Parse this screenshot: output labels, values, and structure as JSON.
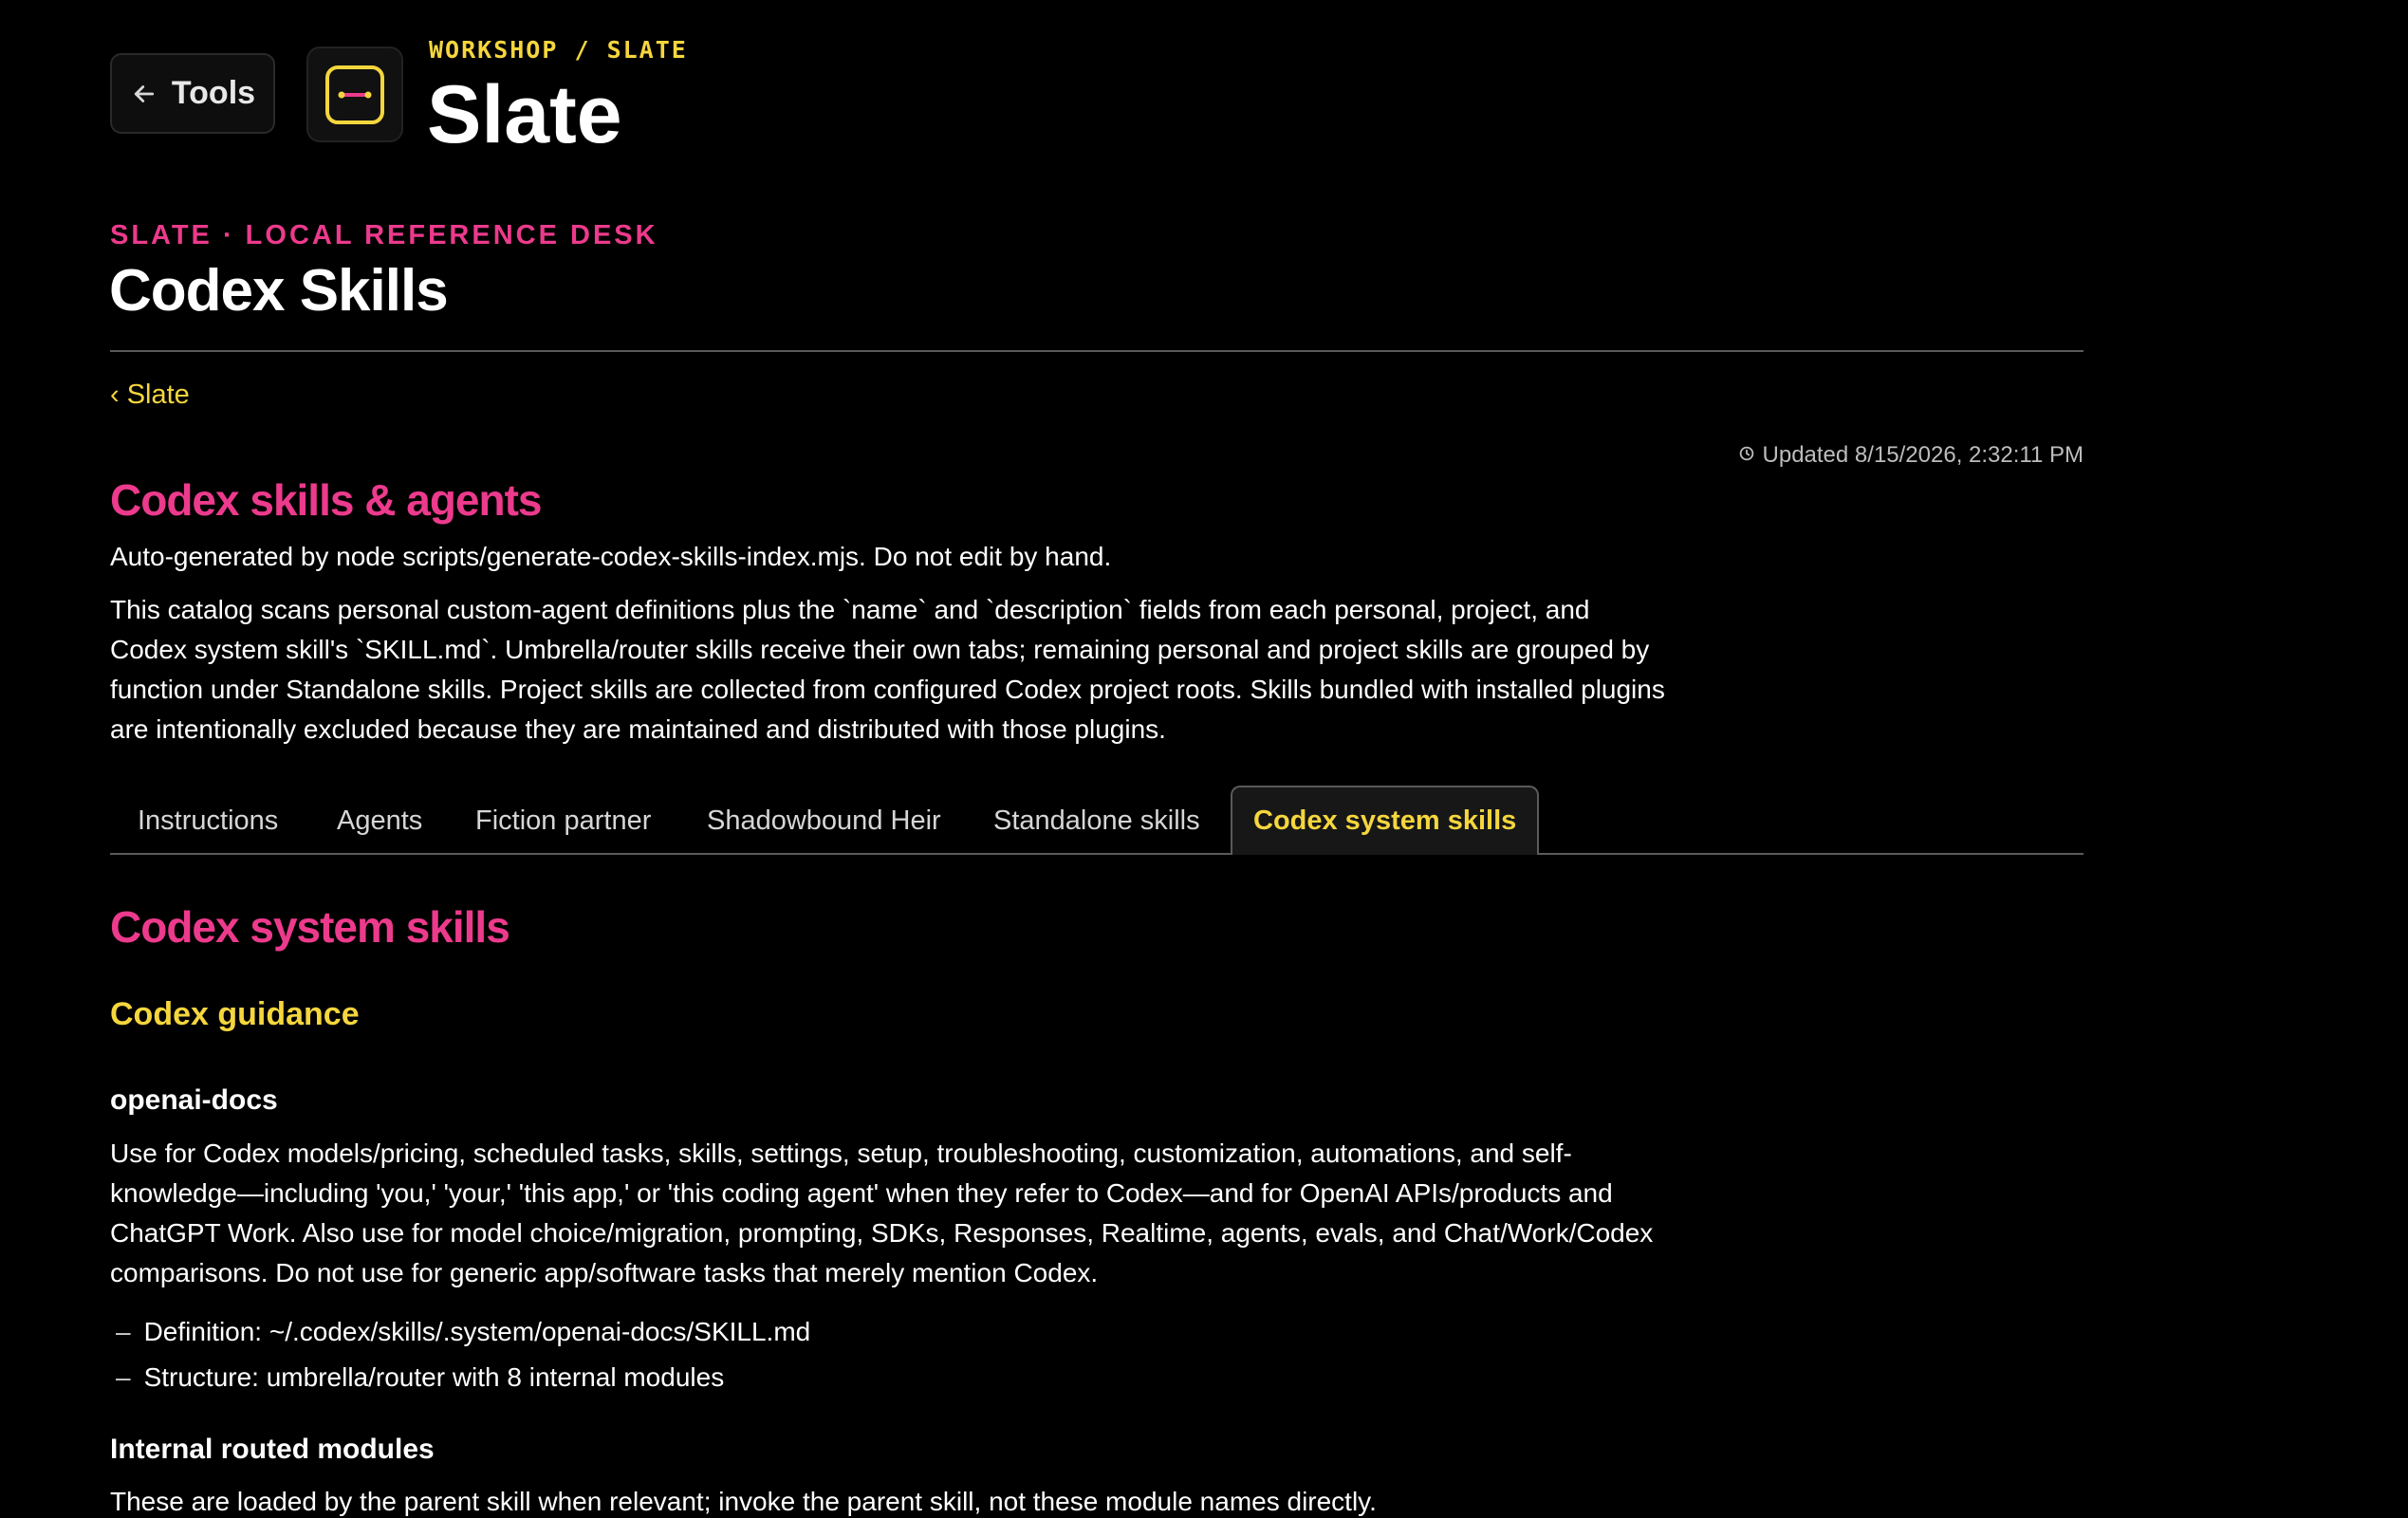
{
  "topbar": {
    "back_label": "Tools",
    "back_icon": "arrow-left-icon",
    "app_icon": "slate-app-icon",
    "breadcrumb": "WORKSHOP / SLATE",
    "app_title": "Slate"
  },
  "header": {
    "eyebrow": "SLATE · LOCAL REFERENCE DESK",
    "title": "Codex Skills",
    "back_link": "‹ Slate"
  },
  "meta": {
    "updated_icon": "clock-icon",
    "updated": "Updated 8/15/2026, 2:32:11 PM"
  },
  "intro": {
    "heading": "Codex skills & agents",
    "autogen": "Auto-generated by node scripts/generate-codex-skills-index.mjs. Do not edit by hand.",
    "description": "This catalog scans personal custom-agent definitions plus the `name` and `description` fields from each personal, project, and Codex system skill's `SKILL.md`. Umbrella/router skills receive their own tabs; remaining personal and project skills are grouped by function under Standalone skills. Project skills are collected from configured Codex project roots. Skills bundled with installed plugins are intentionally excluded because they are maintained and distributed with those plugins."
  },
  "tabs": [
    {
      "label": "Instructions",
      "active": false
    },
    {
      "label": "Agents",
      "active": false
    },
    {
      "label": "Fiction partner",
      "active": false
    },
    {
      "label": "Shadowbound Heir",
      "active": false
    },
    {
      "label": "Standalone skills",
      "active": false
    },
    {
      "label": "Codex system skills",
      "active": true
    }
  ],
  "content": {
    "section_title": "Codex system skills",
    "group_title": "Codex guidance",
    "skill": {
      "name": "openai-docs",
      "description": "Use for Codex models/pricing, scheduled tasks, skills, settings, setup, troubleshooting, customization, automations, and self-knowledge—including 'you,' 'your,' 'this app,' or 'this coding agent' when they refer to Codex—and for OpenAI APIs/products and ChatGPT Work. Also use for model choice/migration, prompting, SDKs, Responses, Realtime, agents, evals, and Chat/Work/Codex comparisons. Do not use for generic app/software tasks that merely mention Codex.",
      "details": [
        {
          "bullet": "–",
          "text": "Definition: ~/.codex/skills/.system/openai-docs/SKILL.md"
        },
        {
          "bullet": "–",
          "text": "Structure: umbrella/router with 8 internal modules"
        }
      ]
    },
    "modules_title": "Internal routed modules",
    "modules_note": "These are loaded by the parent skill when relevant; invoke the parent skill, not these module names directly."
  },
  "colors": {
    "background": "#000000",
    "accent_pink": "#ec3a8c",
    "accent_yellow": "#f5d63d",
    "divider": "#5a5a5a"
  }
}
